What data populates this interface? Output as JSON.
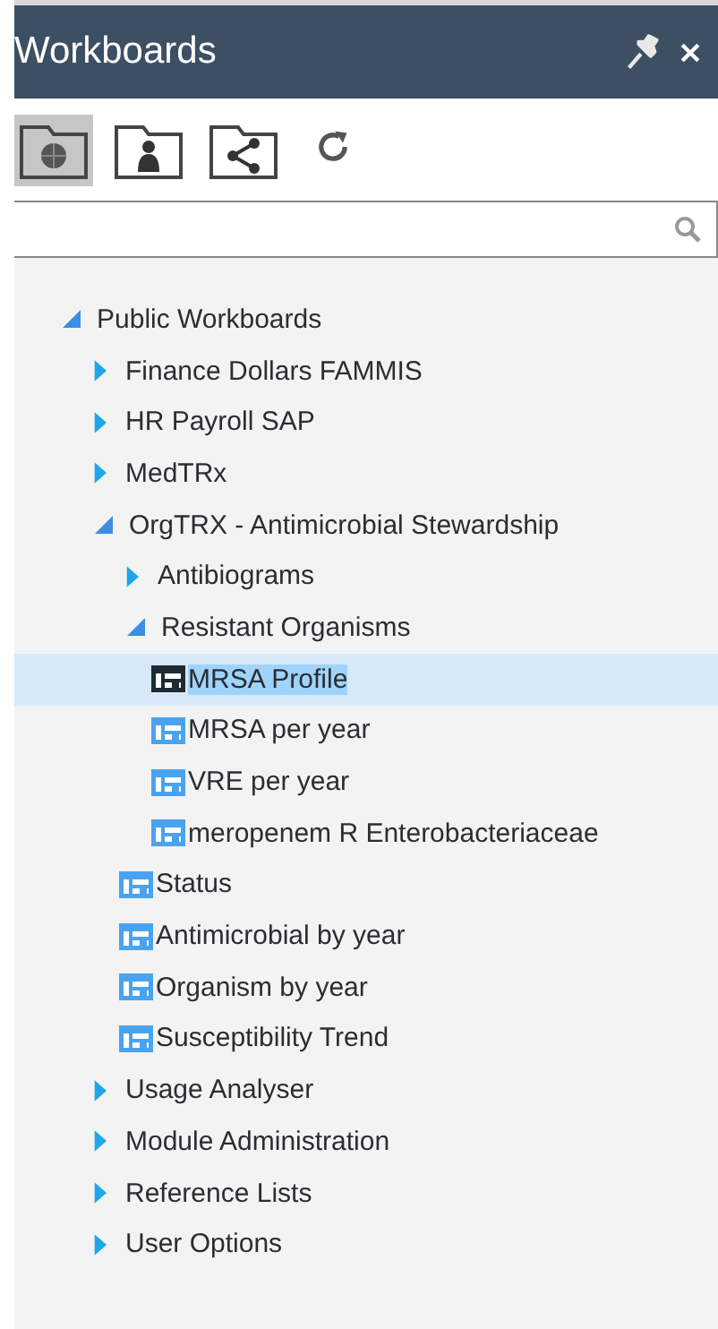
{
  "window": {
    "title": "Workboards"
  },
  "toolbar": [
    {
      "kind": "globe",
      "selected": true
    },
    {
      "kind": "person",
      "selected": false
    },
    {
      "kind": "share",
      "selected": false
    },
    {
      "kind": "refresh",
      "selected": false
    }
  ],
  "tree": [
    {
      "label": "Public Workboards",
      "kind": "folder",
      "expanded": true,
      "children": [
        {
          "label": "Finance Dollars FAMMIS",
          "kind": "folder",
          "expanded": false
        },
        {
          "label": "HR Payroll SAP",
          "kind": "folder",
          "expanded": false
        },
        {
          "label": "MedTRx",
          "kind": "folder",
          "expanded": false
        },
        {
          "label": "OrgTRX - Antimicrobial Stewardship",
          "kind": "folder",
          "expanded": true,
          "children": [
            {
              "label": "Antibiograms",
              "kind": "folder",
              "expanded": false
            },
            {
              "label": "Resistant Organisms",
              "kind": "folder",
              "expanded": true,
              "children": [
                {
                  "label": "MRSA Profile",
                  "kind": "workboard",
                  "selected": true
                },
                {
                  "label": "MRSA per year",
                  "kind": "workboard",
                  "selected": false
                },
                {
                  "label": "VRE per year",
                  "kind": "workboard",
                  "selected": false
                },
                {
                  "label": "meropenem R Enterobacteriaceae",
                  "kind": "workboard",
                  "selected": false
                }
              ]
            },
            {
              "label": "Status",
              "kind": "workboard",
              "selected": false
            },
            {
              "label": "Antimicrobial by year",
              "kind": "workboard",
              "selected": false
            },
            {
              "label": "Organism by year",
              "kind": "workboard",
              "selected": false
            },
            {
              "label": "Susceptibility Trend",
              "kind": "workboard",
              "selected": false
            }
          ]
        },
        {
          "label": "Usage Analyser",
          "kind": "folder",
          "expanded": false
        },
        {
          "label": "Module Administration",
          "kind": "folder",
          "expanded": false
        },
        {
          "label": "Reference Lists",
          "kind": "folder",
          "expanded": false
        },
        {
          "label": "User Options",
          "kind": "folder",
          "expanded": false
        }
      ]
    }
  ]
}
